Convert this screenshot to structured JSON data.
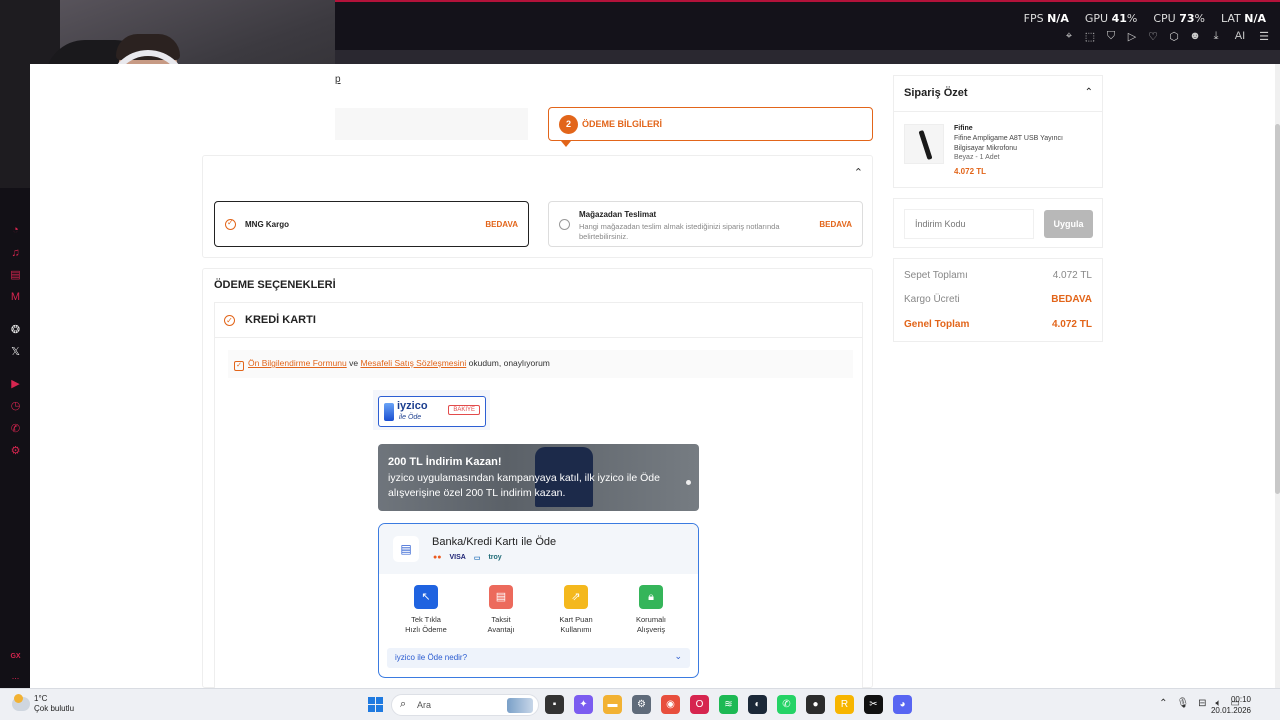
{
  "colors": {
    "accent": "#e2651a",
    "iyzico_blue": "#2a5bd0",
    "sidebar_red": "#d6254f"
  },
  "overlay": {
    "stats": [
      {
        "label": "FPS",
        "value": "N/A"
      },
      {
        "label": "GPU",
        "value": "41",
        "unit": "%"
      },
      {
        "label": "CPU",
        "value": "73",
        "unit": "%"
      },
      {
        "label": "LAT",
        "value": "N/A"
      }
    ]
  },
  "browser": {
    "toolbar_icons": [
      "pin-icon",
      "crop-icon",
      "shield-icon",
      "play-icon",
      "heart-icon",
      "extensions-icon",
      "profile-icon",
      "download-icon",
      "ai-icon",
      "menu-icon"
    ],
    "ai_label": "AI"
  },
  "sidebar": {
    "icons": [
      "speed-dial-icon",
      "music-icon",
      "messenger-icon",
      "mail-icon",
      "chatgpt-icon",
      "x-icon",
      "player-icon",
      "history-icon",
      "whatsapp-icon",
      "settings-icon"
    ],
    "footer": "GX",
    "more": "..."
  },
  "checkout": {
    "back_link": "p",
    "step": {
      "number": "2",
      "label": "ÖDEME BİLGİLERİ"
    },
    "shipping": {
      "options": [
        {
          "name": "MNG Kargo",
          "desc": "",
          "price": "BEDAVA",
          "selected": true
        },
        {
          "name": "Mağazadan Teslimat",
          "desc": "Hangi mağazadan teslim almak istediğinizi sipariş notlarında belirtebilirsiniz.",
          "price": "BEDAVA",
          "selected": false
        }
      ]
    },
    "payment": {
      "title": "ÖDEME SEÇENEKLERİ",
      "method": "KREDİ KARTI",
      "agreement": {
        "link1": "Ön Bilgilendirme Formunu",
        "mid": " ve ",
        "link2": "Mesafeli Satış Sözleşmesini",
        "tail": " okudum, onaylıyorum"
      }
    },
    "iyzico": {
      "logo": "iyzico",
      "logo_sub": "ile Öde",
      "badge": "BAKİYE",
      "promo_title": "200 TL İndirim Kazan!",
      "promo_text": "iyzico uygulamasından kampanyaya katıl, ilk iyzico ile Öde alışverişine özel 200 TL indirim kazan.",
      "bank_title": "Banka/Kredi Kartı ile Öde",
      "card_brands": [
        {
          "name": "mastercard",
          "text": "●●",
          "color": "#eb5a1e"
        },
        {
          "name": "visa",
          "text": "VISA",
          "color": "#1a1f71"
        },
        {
          "name": "amex",
          "text": "▭",
          "color": "#2e77bc"
        },
        {
          "name": "troy",
          "text": "troy",
          "color": "#1f6b77"
        }
      ],
      "features": [
        {
          "line1": "Tek Tıkla",
          "line2": "Hızlı Ödeme",
          "icon": "cursor-icon",
          "color": "#1f63e0",
          "glyph": "↖"
        },
        {
          "line1": "Taksit",
          "line2": "Avantajı",
          "icon": "card-plus-icon",
          "color": "#ec6a5c",
          "glyph": "▤"
        },
        {
          "line1": "Kart Puan",
          "line2": "Kullanımı",
          "icon": "points-icon",
          "color": "#f4b81d",
          "glyph": "⇗"
        },
        {
          "line1": "Korumalı",
          "line2": "Alışveriş",
          "icon": "lock-icon",
          "color": "#35b55a",
          "glyph": "🔒︎"
        }
      ],
      "faq": "iyzico ile Öde nedir?"
    }
  },
  "summary": {
    "title": "Sipariş Özet",
    "item": {
      "brand": "Fifine",
      "name": "Fifine Ampligame A8T USB Yayıncı Bilgisayar Mikrofonu",
      "variant": "Beyaz - 1 Adet",
      "price": "4.072 TL"
    },
    "coupon_placeholder": "İndirim Kodu",
    "apply": "Uygula",
    "rows": [
      {
        "label": "Sepet Toplamı",
        "value": "4.072 TL"
      },
      {
        "label": "Kargo Ücreti",
        "value": "BEDAVA"
      },
      {
        "label": "Genel Toplam",
        "value": "4.072 TL"
      }
    ]
  },
  "taskbar": {
    "weather_temp": "1°C",
    "weather_desc": "Çok bulutlu",
    "search": "Ara",
    "apps": [
      {
        "name": "task-view-icon",
        "glyph": "▪",
        "bg": "#333"
      },
      {
        "name": "copilot-icon",
        "glyph": "✦",
        "bg": "#7b5cf0"
      },
      {
        "name": "file-explorer-icon",
        "glyph": "▬",
        "bg": "#f2b233"
      },
      {
        "name": "settings-icon",
        "glyph": "⚙",
        "bg": "#5f6b7a"
      },
      {
        "name": "chrome-icon",
        "glyph": "◉",
        "bg": "#e84f3d"
      },
      {
        "name": "opera-gx-icon",
        "glyph": "O",
        "bg": "#d6254f"
      },
      {
        "name": "spotify-icon",
        "glyph": "≋",
        "bg": "#1db954"
      },
      {
        "name": "steam-icon",
        "glyph": "◐",
        "bg": "#1b2838"
      },
      {
        "name": "whatsapp-icon",
        "glyph": "✆",
        "bg": "#25d366"
      },
      {
        "name": "obs-icon",
        "glyph": "●",
        "bg": "#2c2c2c"
      },
      {
        "name": "rockstar-icon",
        "glyph": "R",
        "bg": "#f7b500"
      },
      {
        "name": "capcut-icon",
        "glyph": "✂",
        "bg": "#111"
      },
      {
        "name": "discord-icon",
        "glyph": "◕",
        "bg": "#5865f2"
      }
    ],
    "time": "00:10",
    "date": "20.01.2026"
  }
}
